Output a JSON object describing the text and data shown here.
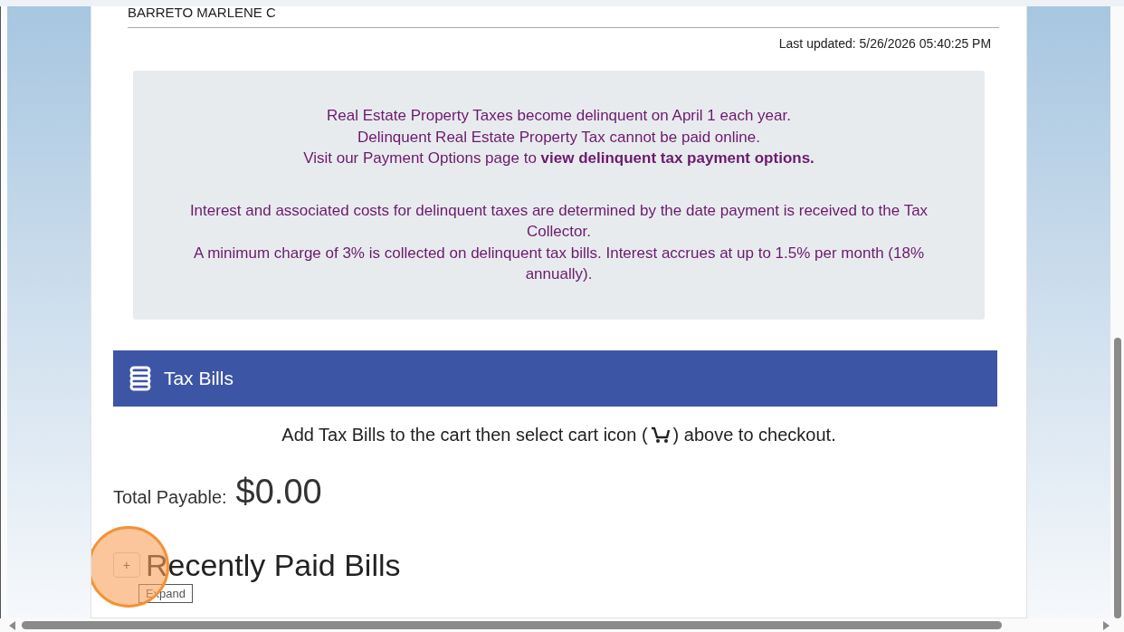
{
  "owner_name": "BARRETO MARLENE C",
  "last_updated": "Last updated: 5/26/2026 05:40:25 PM",
  "notice": {
    "lines": [
      "Real Estate Property Taxes become delinquent on April 1 each year.",
      "Delinquent Real Estate Property Tax cannot be paid online."
    ],
    "link_line": {
      "text": "Visit our Payment Options page to ",
      "link": "view delinquent tax payment options."
    },
    "paragraphs": [
      "Interest and associated costs for delinquent taxes are determined by the date payment is received to the Tax Collector.",
      "A minimum charge of 3% is collected on delinquent tax bills. Interest accrues at up to 1.5% per month (18% annually)."
    ]
  },
  "tax_bills": {
    "title": "Tax Bills",
    "instruction_before": "Add Tax Bills to the cart then select cart icon (",
    "instruction_after": ") above to checkout.",
    "total_label": "Total Payable:",
    "total_value": "$0.00"
  },
  "recently_paid": {
    "toggle": "+",
    "title": "Recently Paid Bills",
    "expanded": false,
    "tooltip": "Expand"
  }
}
